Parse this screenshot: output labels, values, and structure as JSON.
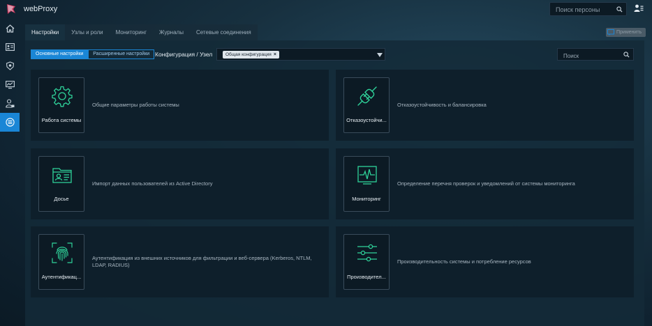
{
  "app": {
    "title": "webProxy"
  },
  "header": {
    "person_search_placeholder": "Поиск персоны"
  },
  "sidebar": {
    "items": [
      {
        "icon": "home-icon"
      },
      {
        "icon": "id-card-icon"
      },
      {
        "icon": "badge-icon"
      },
      {
        "icon": "monitor-chart-icon"
      },
      {
        "icon": "user-lock-icon"
      },
      {
        "icon": "settings-list-icon",
        "active": true
      }
    ]
  },
  "tabs": [
    {
      "label": "Настройки",
      "active": true
    },
    {
      "label": "Узлы и роли"
    },
    {
      "label": "Мониторинг"
    },
    {
      "label": "Журналы"
    },
    {
      "label": "Сетевые соединения"
    }
  ],
  "toolbar": {
    "apply_label": "Применить"
  },
  "settings_mode": {
    "basic_label": "Основные настройки",
    "advanced_label": "Расширенные настройки"
  },
  "config": {
    "label": "Конфигурация / Узел",
    "selected_chip": "Общая конфигурация"
  },
  "search": {
    "placeholder": "Поиск"
  },
  "colors": {
    "accent": "#1a86d6",
    "icon_green": "#2fd39a"
  },
  "cards": [
    {
      "title": "Работа системы",
      "description": "Общие параметры работы системы",
      "icon": "gear-icon"
    },
    {
      "title": "Отказоустойчи...",
      "description": "Отказоустойчивость и балансировка",
      "icon": "plug-icon"
    },
    {
      "title": "Досье",
      "description": "Импорт данных пользователей из Active Directory",
      "icon": "user-folder-icon"
    },
    {
      "title": "Мониторинг",
      "description": "Определение перечня проверок и уведомлений от системы мониторинга",
      "icon": "pulse-monitor-icon"
    },
    {
      "title": "Аутентификац...",
      "description": "Аутентификация из внешних источников для фильтрации и веб-сервера (Kerberos, NTLM, LDAP, RADIUS)",
      "icon": "fingerprint-icon"
    },
    {
      "title": "Производител...",
      "description": "Производительность системы и потребление ресурсов",
      "icon": "sliders-icon"
    }
  ]
}
